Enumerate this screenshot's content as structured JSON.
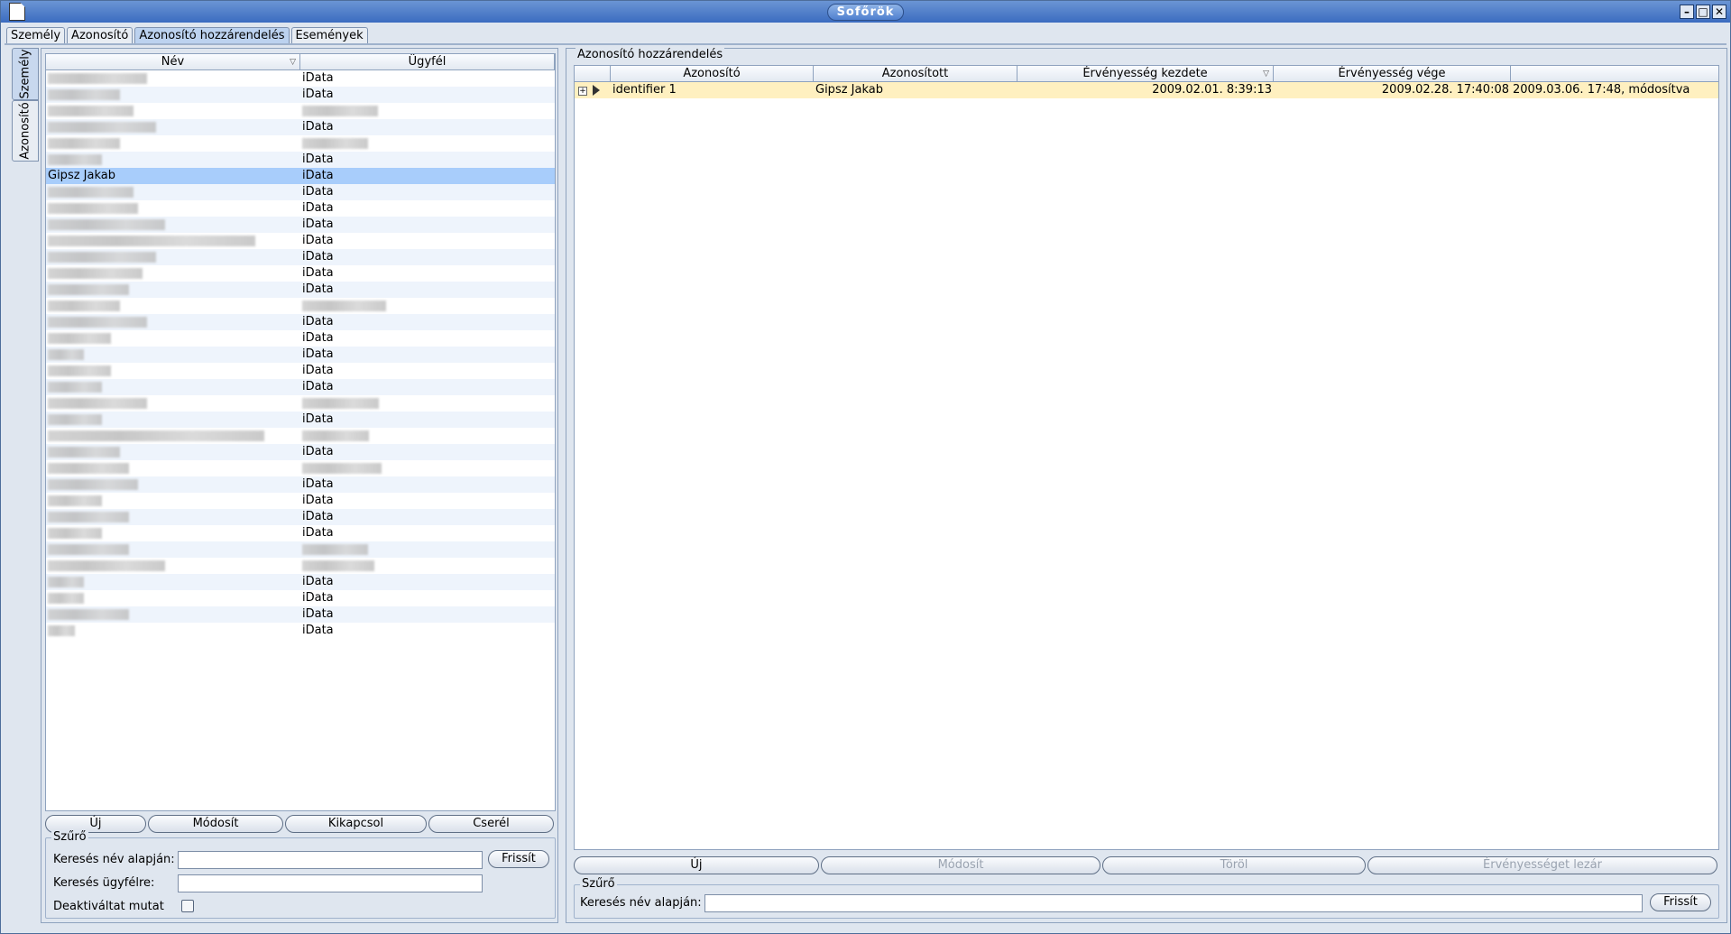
{
  "window": {
    "title": "Sofőrök",
    "controls": [
      "minimize-icon",
      "maximize-icon",
      "close-icon"
    ]
  },
  "tabs": [
    "Személy",
    "Azonosító",
    "Azonosító hozzárendelés",
    "Események"
  ],
  "active_tab": "Azonosító hozzárendelés",
  "side_tabs": [
    "Személy",
    "Azonosító"
  ],
  "left": {
    "columns": [
      "Név",
      "Ügyfél"
    ],
    "rows": [
      {
        "name": "",
        "client": "iData"
      },
      {
        "name": "",
        "client": "iData"
      },
      {
        "name": "",
        "client": ""
      },
      {
        "name": "",
        "client": "iData"
      },
      {
        "name": "",
        "client": ""
      },
      {
        "name": "",
        "client": "iData"
      },
      {
        "name": "Gipsz Jakab",
        "client": "iData",
        "selected": true
      },
      {
        "name": "",
        "client": "iData"
      },
      {
        "name": "",
        "client": "iData"
      },
      {
        "name": "",
        "client": "iData"
      },
      {
        "name": "",
        "client": "iData"
      },
      {
        "name": "",
        "client": "iData"
      },
      {
        "name": "",
        "client": "iData"
      },
      {
        "name": "",
        "client": "iData"
      },
      {
        "name": "",
        "client": ""
      },
      {
        "name": "",
        "client": "iData"
      },
      {
        "name": "",
        "client": "iData"
      },
      {
        "name": "",
        "client": "iData"
      },
      {
        "name": "",
        "client": "iData"
      },
      {
        "name": "",
        "client": "iData"
      },
      {
        "name": "",
        "client": ""
      },
      {
        "name": "",
        "client": "iData"
      },
      {
        "name": "",
        "client": ""
      },
      {
        "name": "",
        "client": "iData"
      },
      {
        "name": "",
        "client": ""
      },
      {
        "name": "",
        "client": "iData"
      },
      {
        "name": "",
        "client": "iData"
      },
      {
        "name": "",
        "client": "iData"
      },
      {
        "name": "",
        "client": "iData"
      },
      {
        "name": "",
        "client": ""
      },
      {
        "name": "",
        "client": ""
      },
      {
        "name": "",
        "client": "iData"
      },
      {
        "name": "",
        "client": "iData"
      },
      {
        "name": "",
        "client": "iData"
      },
      {
        "name": "",
        "client": "iData"
      }
    ],
    "buttons": {
      "new": "Új",
      "modify": "Módosít",
      "disconnect": "Kikapcsol",
      "replace": "Cserél"
    },
    "filter": {
      "legend": "Szűrő",
      "by_name_label": "Keresés név alapján:",
      "by_client_label": "Keresés ügyfélre:",
      "show_deactivated_label": "Deaktiváltat mutat",
      "refresh": "Frissít",
      "by_name_value": "",
      "by_client_value": ""
    }
  },
  "right": {
    "title": "Azonosító hozzárendelés",
    "columns": [
      "",
      "Azonosító",
      "Azonosított",
      "Érvényesség kezdete",
      "Érvényesség vége",
      ""
    ],
    "rows": [
      {
        "id": "identifier 1",
        "identified": "Gipsz Jakab",
        "start": "2009.02.01. 8:39:13",
        "end": "2009.02.28. 17:40:08",
        "modified": "2009.03.06. 17:48, módosítva"
      }
    ],
    "buttons": {
      "new": "Új",
      "modify": "Módosít",
      "delete": "Töröl",
      "close_validity": "Érvényességet lezár"
    },
    "filter": {
      "legend": "Szűrő",
      "by_name_label": "Keresés név alapján:",
      "refresh": "Frissít",
      "by_name_value": ""
    }
  }
}
